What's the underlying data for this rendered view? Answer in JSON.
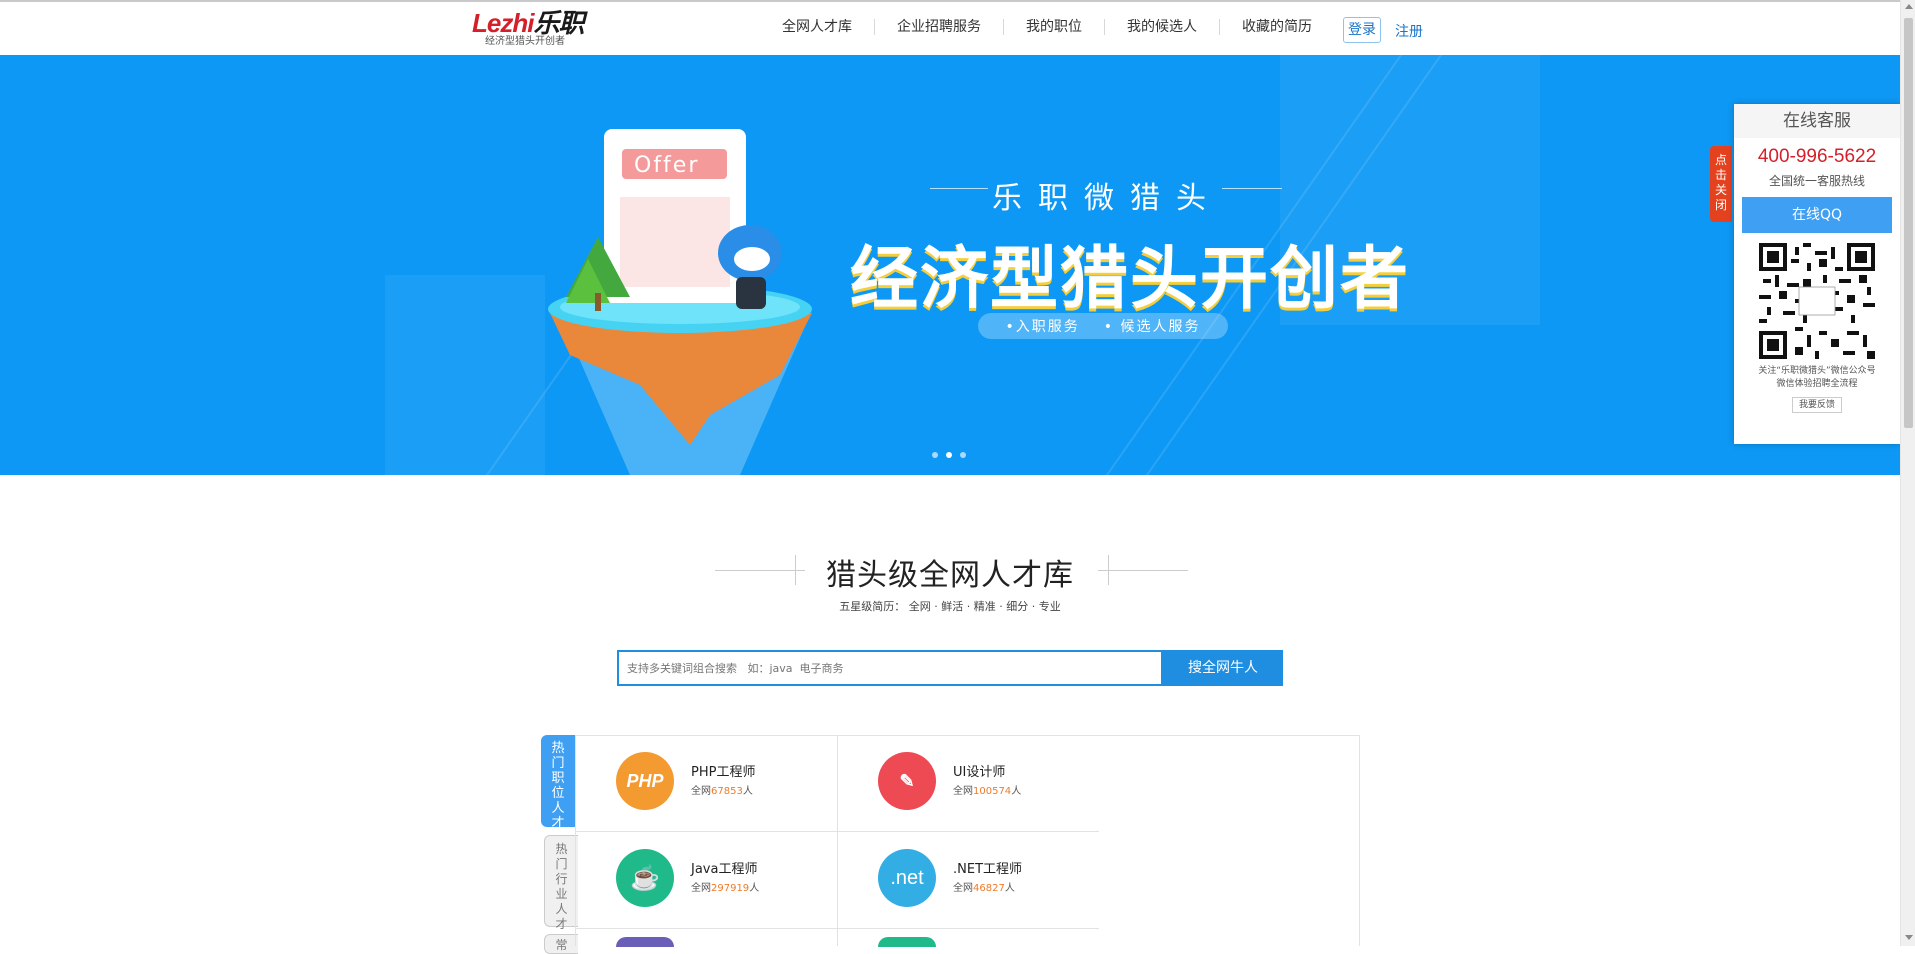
{
  "header": {
    "logo_text_a": "Le",
    "logo_text_b": "zhi",
    "logo_text_c": "乐职",
    "logo_tagline": "经济型猎头开创者",
    "nav": [
      "全网人才库",
      "企业招聘服务",
      "我的职位",
      "我的候选人",
      "收藏的简历"
    ],
    "login": "登录",
    "register": "注册"
  },
  "banner": {
    "offer_label": "Offer",
    "subtitle": "乐职微猎头",
    "title": "经济型猎头开创者",
    "pill_1": "•入职服务",
    "pill_2": "• 候选人服务",
    "slides": 3,
    "active_slide": 2
  },
  "section": {
    "title": "猎头级全网人才库",
    "subtitle": "五星级简历： 全网 · 鲜活 · 精准 · 细分 · 专业"
  },
  "search": {
    "placeholder": "支持多关键词组合搜索   如：java  电子商务",
    "button": "搜全网牛人"
  },
  "tabs": [
    "热门职位人才",
    "热门行业人才",
    "常"
  ],
  "categories": [
    {
      "icon_text": "PHP",
      "name": "PHP工程师",
      "prefix": "全网",
      "count": "67853",
      "suffix": "人",
      "color": "#f39a31"
    },
    {
      "icon_text": "✎",
      "name": "UI设计师",
      "prefix": "全网",
      "count": "100574",
      "suffix": "人",
      "color": "#ee4a54"
    },
    {
      "icon_text": "☕",
      "name": "Java工程师",
      "prefix": "全网",
      "count": "297919",
      "suffix": "人",
      "color": "#1fb98a"
    },
    {
      "icon_text": ".net",
      "name": ".NET工程师",
      "prefix": "全网",
      "count": "46827",
      "suffix": "人",
      "color": "#33aee5"
    }
  ],
  "customer_service": {
    "title": "在线客服",
    "phone": "400-996-5622",
    "phone_label": "全国统一客服热线",
    "qq_button": "在线QQ",
    "desc_1": "关注“乐职微猎头”微信公众号",
    "desc_2": "微信体验招聘全流程",
    "feedback": "我要反馈",
    "close_label": "点击关闭"
  },
  "colors": {
    "brand_red": "#d4202a",
    "banner_blue": "#0d98f5",
    "accent_blue": "#1f8de0",
    "count_orange": "#f07a26"
  }
}
